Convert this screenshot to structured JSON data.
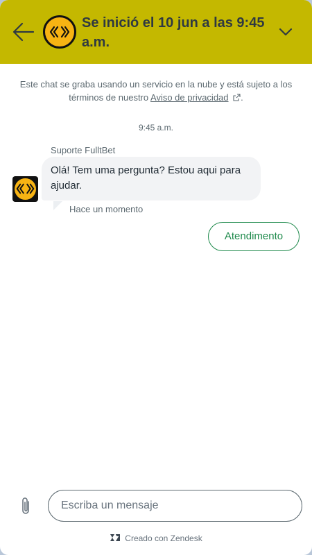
{
  "header": {
    "title": "Se inició el 10 jun a las 9:45 a.m.",
    "back_icon": "arrow-left-icon",
    "collapse_icon": "chevron-down-icon",
    "background": "#c4b800",
    "logo_color": "#f7b313"
  },
  "notice": {
    "text": "Este chat se graba usando un servicio en la nube y está sujeto a los términos de nuestro ",
    "link_label": "Aviso de privacidad",
    "link_icon": "external-link-icon",
    "suffix": "."
  },
  "conversation": {
    "timestamp": "9:45 a.m.",
    "sender": "Suporte FulltBet",
    "message": "Olá! Tem uma pergunta? Estou aqui para ajudar.",
    "status": "Hace un momento",
    "quick_reply": "Atendimento",
    "accent": "#1f8a4c"
  },
  "composer": {
    "placeholder": "Escriba un mensaje",
    "value": "",
    "attach_icon": "paperclip-icon"
  },
  "footer": {
    "label": "Creado con Zendesk",
    "icon": "zendesk-logo-icon"
  }
}
